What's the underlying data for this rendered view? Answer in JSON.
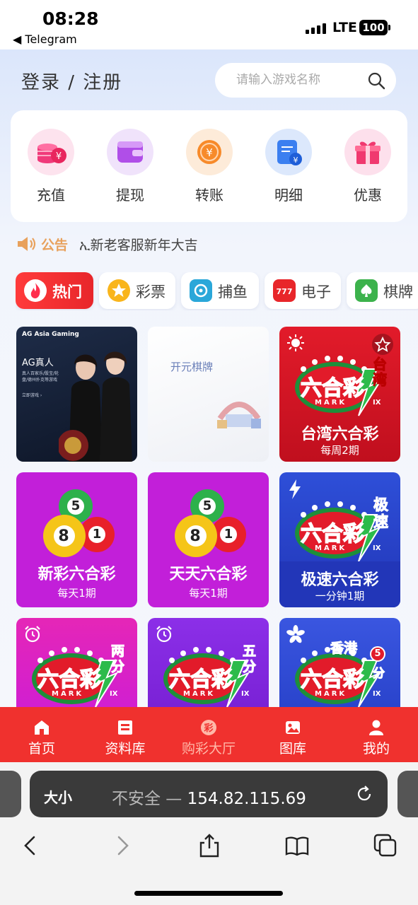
{
  "status": {
    "time": "08:28",
    "back_app": "◀ Telegram",
    "network": "LTE",
    "battery": "100"
  },
  "header": {
    "login": "登录 / 注册",
    "search_placeholder": "请输入游戏名称"
  },
  "actions": [
    {
      "label": "充值",
      "icon": "coins-icon"
    },
    {
      "label": "提现",
      "icon": "wallet-icon"
    },
    {
      "label": "转账",
      "icon": "transfer-icon"
    },
    {
      "label": "明细",
      "icon": "records-icon"
    },
    {
      "label": "优惠",
      "icon": "gift-icon"
    }
  ],
  "notice": {
    "title": "公告",
    "text": "ኢ新老客服新年大吉"
  },
  "categories": [
    {
      "label": "热门",
      "icon": "flame-icon",
      "active": true
    },
    {
      "label": "彩票",
      "icon": "star-icon"
    },
    {
      "label": "捕鱼",
      "icon": "fish-icon"
    },
    {
      "label": "电子",
      "icon": "slot-777-icon"
    },
    {
      "label": "棋牌",
      "icon": "spade-icon"
    }
  ],
  "games": [
    {
      "id": "ag",
      "title": "AG真人",
      "sub": "真人百家乐/骰宝/轮盘/德州扑克等游戏",
      "cta": "立即游戏 ›",
      "brand": "AG Asia Gaming"
    },
    {
      "id": "ky",
      "title": "开元棋牌"
    },
    {
      "id": "tw",
      "title": "台湾六合彩",
      "sub": "每周2期",
      "badge": "台湾",
      "logo": "六合彩",
      "mark": "MARK",
      "ix": "IX"
    },
    {
      "id": "xc",
      "title": "新彩六合彩",
      "sub": "每天1期",
      "balls": [
        "5",
        "8",
        "1"
      ]
    },
    {
      "id": "tt",
      "title": "天天六合彩",
      "sub": "每天1期",
      "balls": [
        "5",
        "8",
        "1"
      ]
    },
    {
      "id": "js",
      "title": "极速六合彩",
      "sub": "一分钟1期",
      "badge": "极速",
      "logo": "六合彩",
      "mark": "MARK",
      "ix": "IX"
    },
    {
      "id": "lf",
      "badge": "两分",
      "logo": "六合彩",
      "mark": "MARK",
      "ix": "IX"
    },
    {
      "id": "wf",
      "badge": "五分",
      "logo": "六合彩",
      "mark": "MARK",
      "ix": "IX"
    },
    {
      "id": "hk",
      "badge": "香港",
      "badge2": "5",
      "badge3": "分",
      "logo": "六合彩",
      "mark": "MARK",
      "ix": "IX"
    }
  ],
  "nav": [
    {
      "label": "首页",
      "icon": "home-icon"
    },
    {
      "label": "资料库",
      "icon": "library-icon"
    },
    {
      "label": "购彩大厅",
      "icon": "lottery-hall-icon",
      "current": true
    },
    {
      "label": "图库",
      "icon": "gallery-icon"
    },
    {
      "label": "我的",
      "icon": "profile-icon"
    }
  ],
  "browser": {
    "text_size": "大小",
    "insecure": "不安全 —",
    "host": "154.82.115.69"
  },
  "colors": {
    "primary_red": "#f0312e",
    "notice_orange": "#e8a15c",
    "purple_tile": "#c21fd9",
    "blue_tile": "#2a44cc"
  }
}
